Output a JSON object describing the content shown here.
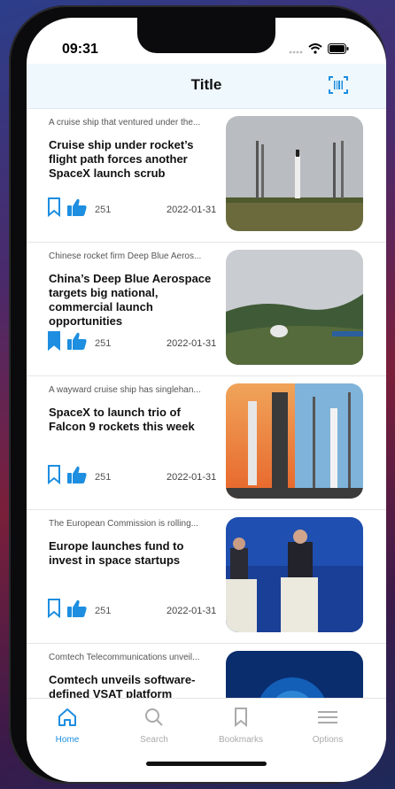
{
  "status": {
    "time": "09:31"
  },
  "navbar": {
    "title": "Title",
    "scan_icon": "barcode-scan-icon"
  },
  "colors": {
    "accent": "#1d8ee0",
    "navbar_bg": "#eef8fd"
  },
  "articles": [
    {
      "teaser": "A cruise ship that ventured under the...",
      "headline": "Cruise ship under rocket’s flight path forces another SpaceX launch scrub",
      "likes": "251",
      "date": "2022-01-31",
      "bookmarked": false
    },
    {
      "teaser": "Chinese rocket firm Deep Blue Aeros...",
      "headline": "China’s Deep Blue Aerospace targets big national, commercial launch opportunities",
      "likes": "251",
      "date": "2022-01-31",
      "bookmarked": true
    },
    {
      "teaser": "A wayward cruise ship has singlehan...",
      "headline": "SpaceX to launch trio of Falcon 9 rockets this week",
      "likes": "251",
      "date": "2022-01-31",
      "bookmarked": false
    },
    {
      "teaser": "The European Commission is rolling...",
      "headline": "Europe launches fund to invest in space startups",
      "likes": "251",
      "date": "2022-01-31",
      "bookmarked": false
    },
    {
      "teaser": "Comtech Telecommunications unveil...",
      "headline": "Comtech unveils software-defined VSAT platform",
      "likes": "",
      "date": "",
      "bookmarked": false
    }
  ],
  "tabbar": {
    "home": "Home",
    "search": "Search",
    "bookmarks": "Bookmarks",
    "options": "Options",
    "active": "Home"
  }
}
